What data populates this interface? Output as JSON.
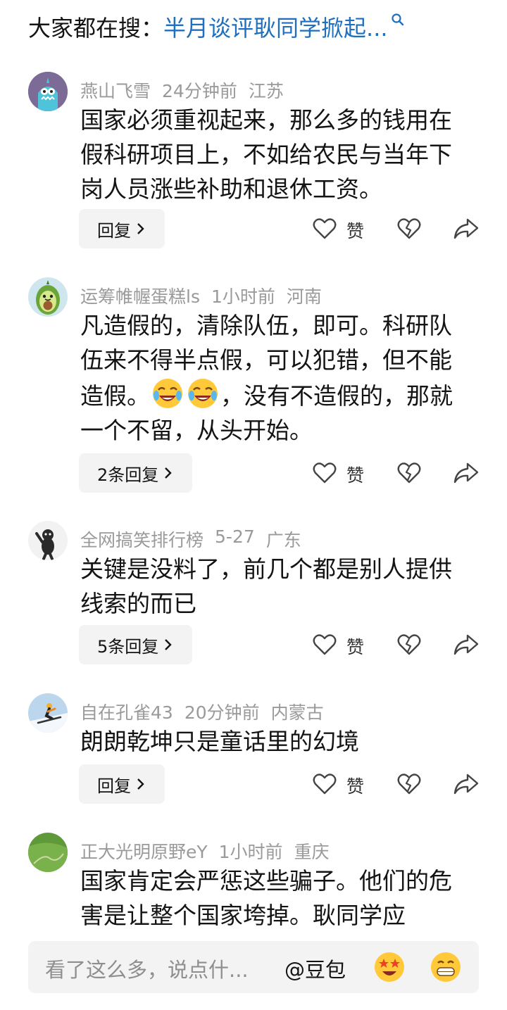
{
  "search": {
    "prefix": "大家都在搜：",
    "query": "半月谈评耿同学掀起..."
  },
  "colors": {
    "link_blue": "#1e6fbf",
    "meta_gray": "#9a9a9a",
    "button_bg": "#f3f3f3"
  },
  "comments": [
    {
      "user": "燕山飞雪",
      "time": "24分钟前",
      "location": "江苏",
      "text": "国家必须重视起来，那么多的钱用在假科研项目上，不如给农民与当年下岗人员涨些补助和退休工资。",
      "reply_label": "回复",
      "avatar": "monster-avatar"
    },
    {
      "user": "运筹帷幄蛋糕ls",
      "time": "1小时前",
      "location": "河南",
      "text_a": "凡造假的，清除队伍，即可。科研队伍来不得半点假，可以犯错，但不能造假。",
      "emojis": [
        "laugh-cry-emoji",
        "laugh-cry-emoji"
      ],
      "text_b": "，没有不造假的，那就一个不留，从头开始。",
      "reply_label": "2条回复",
      "avatar": "avocado-avatar"
    },
    {
      "user": "全网搞笑排行榜",
      "time": "5-27",
      "location": "广东",
      "text": "关键是没料了，前几个都是别人提供线索的而已",
      "reply_label": "5条回复",
      "avatar": "cartoon-figure-avatar"
    },
    {
      "user": "自在孔雀43",
      "time": "20分钟前",
      "location": "内蒙古",
      "text": "朗朗乾坤只是童话里的幻境",
      "reply_label": "回复",
      "avatar": "skier-avatar"
    },
    {
      "user": "正大光明原野eY",
      "time": "1小时前",
      "location": "重庆",
      "text": "国家肯定会严惩这些骗子。他们的危害是让整个国家垮掉。耿同学应",
      "avatar": "grassland-avatar"
    }
  ],
  "actions": {
    "like_label": "赞"
  },
  "input": {
    "placeholder": "看了这么多，说点什...",
    "mention": "@豆包"
  }
}
